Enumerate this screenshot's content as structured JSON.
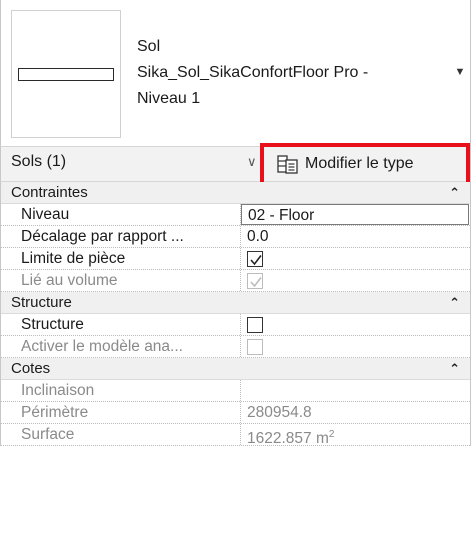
{
  "type_selector": {
    "family": "Sol",
    "type_line1": "Sika_Sol_SikaConfortFloor Pro -",
    "type_line2": "Niveau 1"
  },
  "selector": {
    "count_label": "Sols (1)",
    "edit_type_label": "Modifier le type"
  },
  "sections": {
    "contraintes": {
      "title": "Contraintes",
      "rows": [
        {
          "name": "Niveau",
          "value": "02 - Floor"
        },
        {
          "name": "Décalage par rapport ...",
          "value": "0.0"
        },
        {
          "name": "Limite de pièce",
          "checked": true
        },
        {
          "name": "Lié au volume",
          "checked": true,
          "disabled": true
        }
      ]
    },
    "structure": {
      "title": "Structure",
      "rows": [
        {
          "name": "Structure",
          "checked": false
        },
        {
          "name": "Activer le modèle ana...",
          "checked": false,
          "disabled": true
        }
      ]
    },
    "cotes": {
      "title": "Cotes",
      "rows": [
        {
          "name": "Inclinaison",
          "value": ""
        },
        {
          "name": "Périmètre",
          "value": "280954.8"
        },
        {
          "name": "Surface",
          "value": "1622.857 m",
          "unit_sup": "2"
        }
      ]
    }
  },
  "colors": {
    "highlight": "#e8101a",
    "section_bg": "#f0f0f0",
    "disabled_text": "#8a8a8a"
  }
}
